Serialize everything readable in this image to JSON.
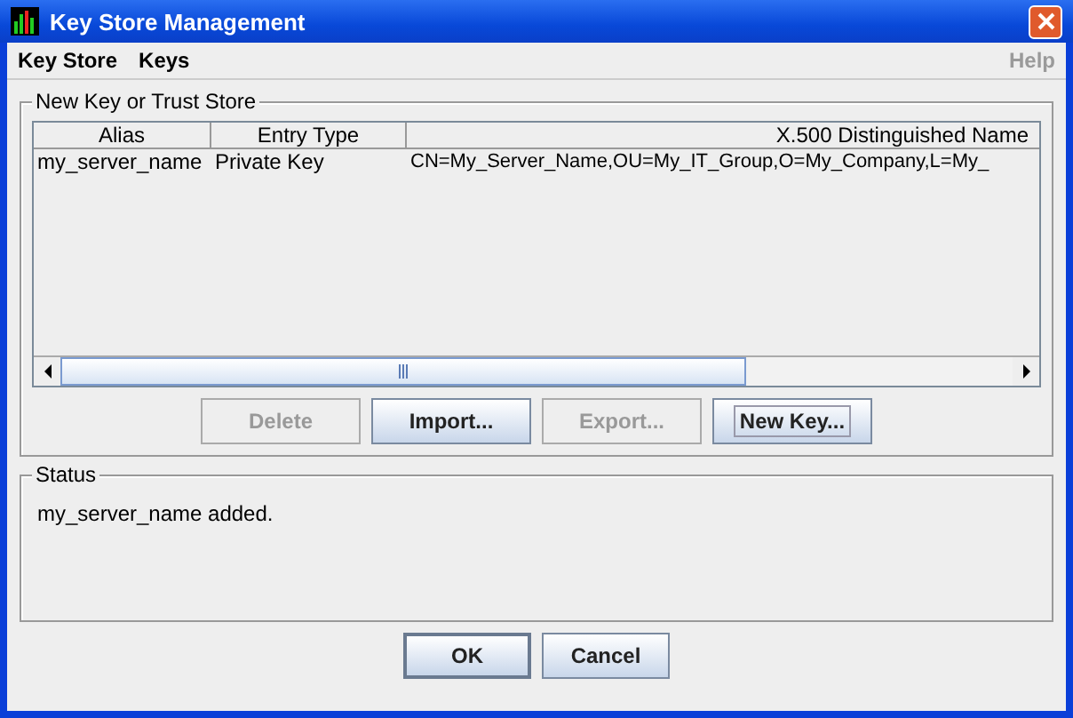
{
  "window": {
    "title": "Key Store Management"
  },
  "menu": [
    {
      "label": "Key Store",
      "disabled": false
    },
    {
      "label": "Keys",
      "disabled": false
    },
    {
      "label": "Help",
      "disabled": true
    }
  ],
  "key_group": {
    "title": "New Key or Trust Store",
    "table": {
      "columns": [
        "Alias",
        "Entry Type",
        "X.500 Distinguished Name"
      ],
      "rows": [
        [
          "my_server_name",
          "Private Key",
          "CN=My_Server_Name,OU=My_IT_Group,O=My_Company,L=My_"
        ]
      ]
    },
    "buttons": [
      {
        "label": "Delete",
        "disabled": true,
        "focused": false
      },
      {
        "label": "Import...",
        "disabled": false,
        "focused": false
      },
      {
        "label": "Export...",
        "disabled": true,
        "focused": false
      },
      {
        "label": "New Key...",
        "disabled": false,
        "focused": true
      }
    ]
  },
  "status_group": {
    "title": "Status",
    "message": "my_server_name added."
  },
  "dialog_buttons": [
    {
      "label": "OK",
      "default": true
    },
    {
      "label": "Cancel",
      "default": false
    }
  ]
}
